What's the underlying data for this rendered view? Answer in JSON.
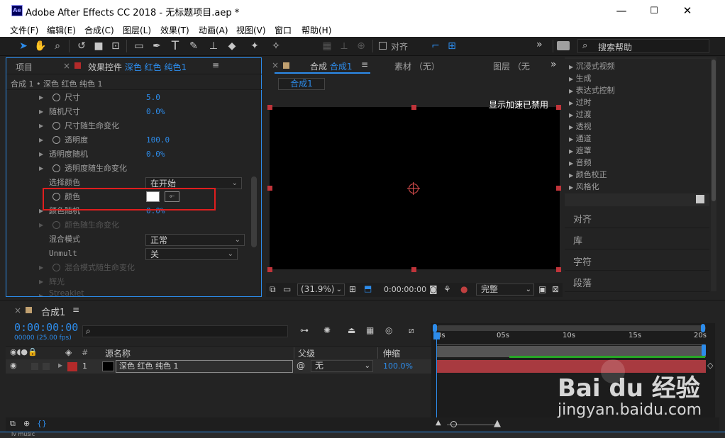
{
  "window": {
    "app_icon": "Ae",
    "title": "Adobe After Effects CC 2018 - 无标题项目.aep *",
    "minimize": "—",
    "maximize": "☐",
    "close": "✕"
  },
  "menu": [
    "文件(F)",
    "编辑(E)",
    "合成(C)",
    "图层(L)",
    "效果(T)",
    "动画(A)",
    "视图(V)",
    "窗口",
    "帮助(H)"
  ],
  "toolbar": {
    "snap_label": "对齐",
    "search_help": "搜索帮助",
    "overflow": "»"
  },
  "left_panel": {
    "tab_project": "项目",
    "tab_effects_prefix": "效果控件",
    "tab_effects_layer": "深色 红色 纯色1",
    "breadcrumb": "合成 1 • 深色 红色 纯色 1",
    "props": [
      {
        "label": "尺寸",
        "value": "5.0"
      },
      {
        "label": "随机尺寸",
        "value": "0.0%"
      },
      {
        "label": "尺寸随生命变化",
        "value": ""
      },
      {
        "label": "透明度",
        "value": "100.0"
      },
      {
        "label": "透明度随机",
        "value": "0.0%"
      },
      {
        "label": "透明度随生命变化",
        "value": ""
      },
      {
        "label": "选择颜色",
        "value": "在开始"
      },
      {
        "label": "颜色",
        "value": ""
      },
      {
        "label": "颜色随机",
        "value": "0.0%"
      },
      {
        "label": "颜色随生命变化",
        "value": ""
      },
      {
        "label": "混合模式",
        "value": "正常"
      },
      {
        "label": "Unmult",
        "value": "关"
      },
      {
        "label": "混合模式随生命变化",
        "value": ""
      },
      {
        "label": "辉光",
        "value": ""
      },
      {
        "label": "Streaklet",
        "value": ""
      }
    ]
  },
  "viewer": {
    "tab_prefix": "合成",
    "tab_comp": "合成1",
    "tab_footage": "素材 （无）",
    "tab_layer": "图层 （无",
    "overflow": "»",
    "comp_button": "合成1",
    "gpu_text": "显示加速已禁用",
    "zoom": "(31.9%)",
    "timecode": "0:00:00:00",
    "quality": "完整"
  },
  "effects_list": [
    "沉浸式视频",
    "生成",
    "表达式控制",
    "过时",
    "过渡",
    "透视",
    "通道",
    "遮罩",
    "音频",
    "颜色校正",
    "风格化"
  ],
  "right_panels": [
    "对齐",
    "库",
    "字符",
    "段落"
  ],
  "timeline": {
    "tab": "合成1",
    "timecode": "0:00:00:00",
    "fps": "00000 (25.00 fps)",
    "col_source": "源名称",
    "col_parent": "父级",
    "col_stretch": "伸缩",
    "ruler": [
      "0s",
      "05s",
      "10s",
      "15s",
      "20s"
    ],
    "layer": {
      "number": "1",
      "name": "深色 红色 纯色 1",
      "parent": "无",
      "stretch": "100.0%",
      "label_color": "#b42a2a"
    }
  },
  "colors": {
    "accent": "#2d8ceb",
    "highlight_box": "#e01e1e",
    "layer_bar": "#a83a40"
  },
  "watermark": {
    "brand": "Bai du 经验",
    "url": "jingyan.baidu.com"
  },
  "bottom_fragment": "lv music"
}
